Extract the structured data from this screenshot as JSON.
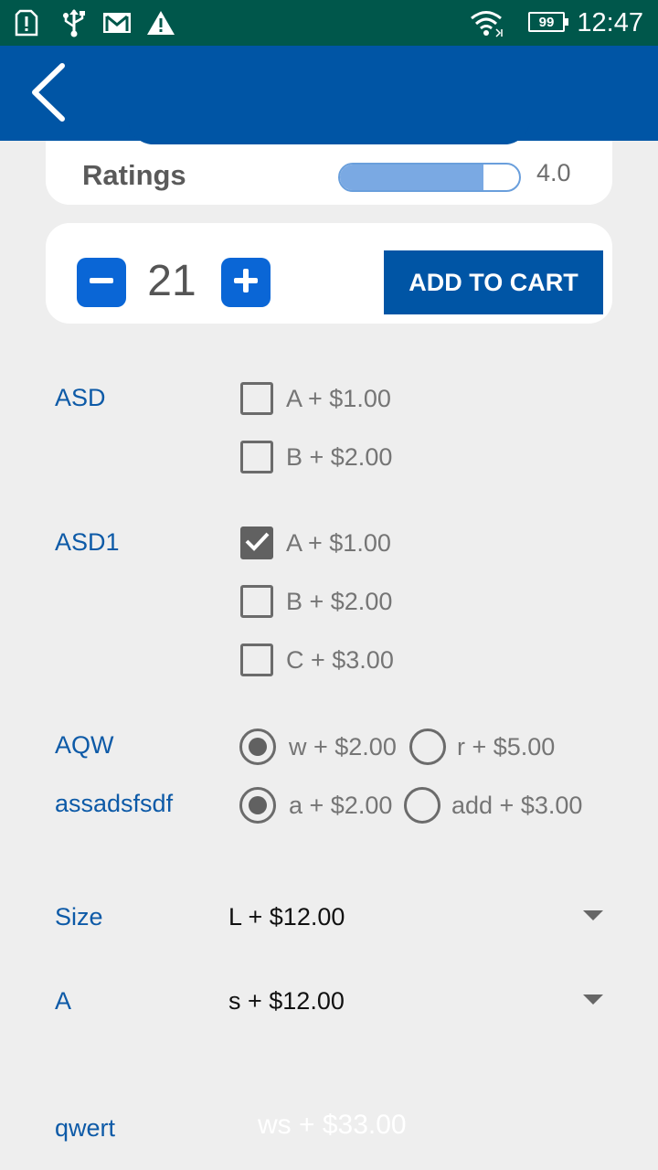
{
  "status_bar": {
    "time": "12:47",
    "battery": "99",
    "icons": [
      "sim-alert-icon",
      "usb-icon",
      "gmail-icon",
      "warning-icon",
      "wifi-icon",
      "battery-icon"
    ]
  },
  "app_bar": {
    "back_icon": "chevron-left-icon",
    "color": "#0055a5"
  },
  "ratings": {
    "label": "Ratings",
    "value": "4.0",
    "bar_fill_fraction": 0.8
  },
  "cart": {
    "quantity": "21",
    "add_to_cart_label": "ADD TO CART",
    "minus_icon": "minus-icon",
    "plus_icon": "plus-icon"
  },
  "options": {
    "asd": {
      "label": "ASD",
      "items": [
        {
          "text": "A + $1.00",
          "checked": false
        },
        {
          "text": "B + $2.00",
          "checked": false
        }
      ]
    },
    "asd1": {
      "label": "ASD1",
      "items": [
        {
          "text": "A + $1.00",
          "checked": true
        },
        {
          "text": "B + $2.00",
          "checked": false
        },
        {
          "text": "C + $3.00",
          "checked": false
        }
      ]
    },
    "aqw": {
      "label": "AQW",
      "items": [
        {
          "text": "w + $2.00",
          "selected": true
        },
        {
          "text": "r + $5.00",
          "selected": false
        }
      ]
    },
    "assadsfsdf": {
      "label": "assadsfsdf",
      "items": [
        {
          "text": "a + $2.00",
          "selected": true
        },
        {
          "text": "add + $3.00",
          "selected": false
        }
      ]
    }
  },
  "dropdowns": {
    "size": {
      "label": "Size",
      "value": "L + $12.00"
    },
    "a": {
      "label": "A",
      "value": "s + $12.00"
    }
  },
  "qwert": {
    "label": "qwert",
    "value": "ws + $33.00"
  },
  "colors": {
    "accent": "#0055a5",
    "status_bar": "#00574b",
    "button_blue": "#0a66d6",
    "label_blue": "#0d5aa7"
  }
}
